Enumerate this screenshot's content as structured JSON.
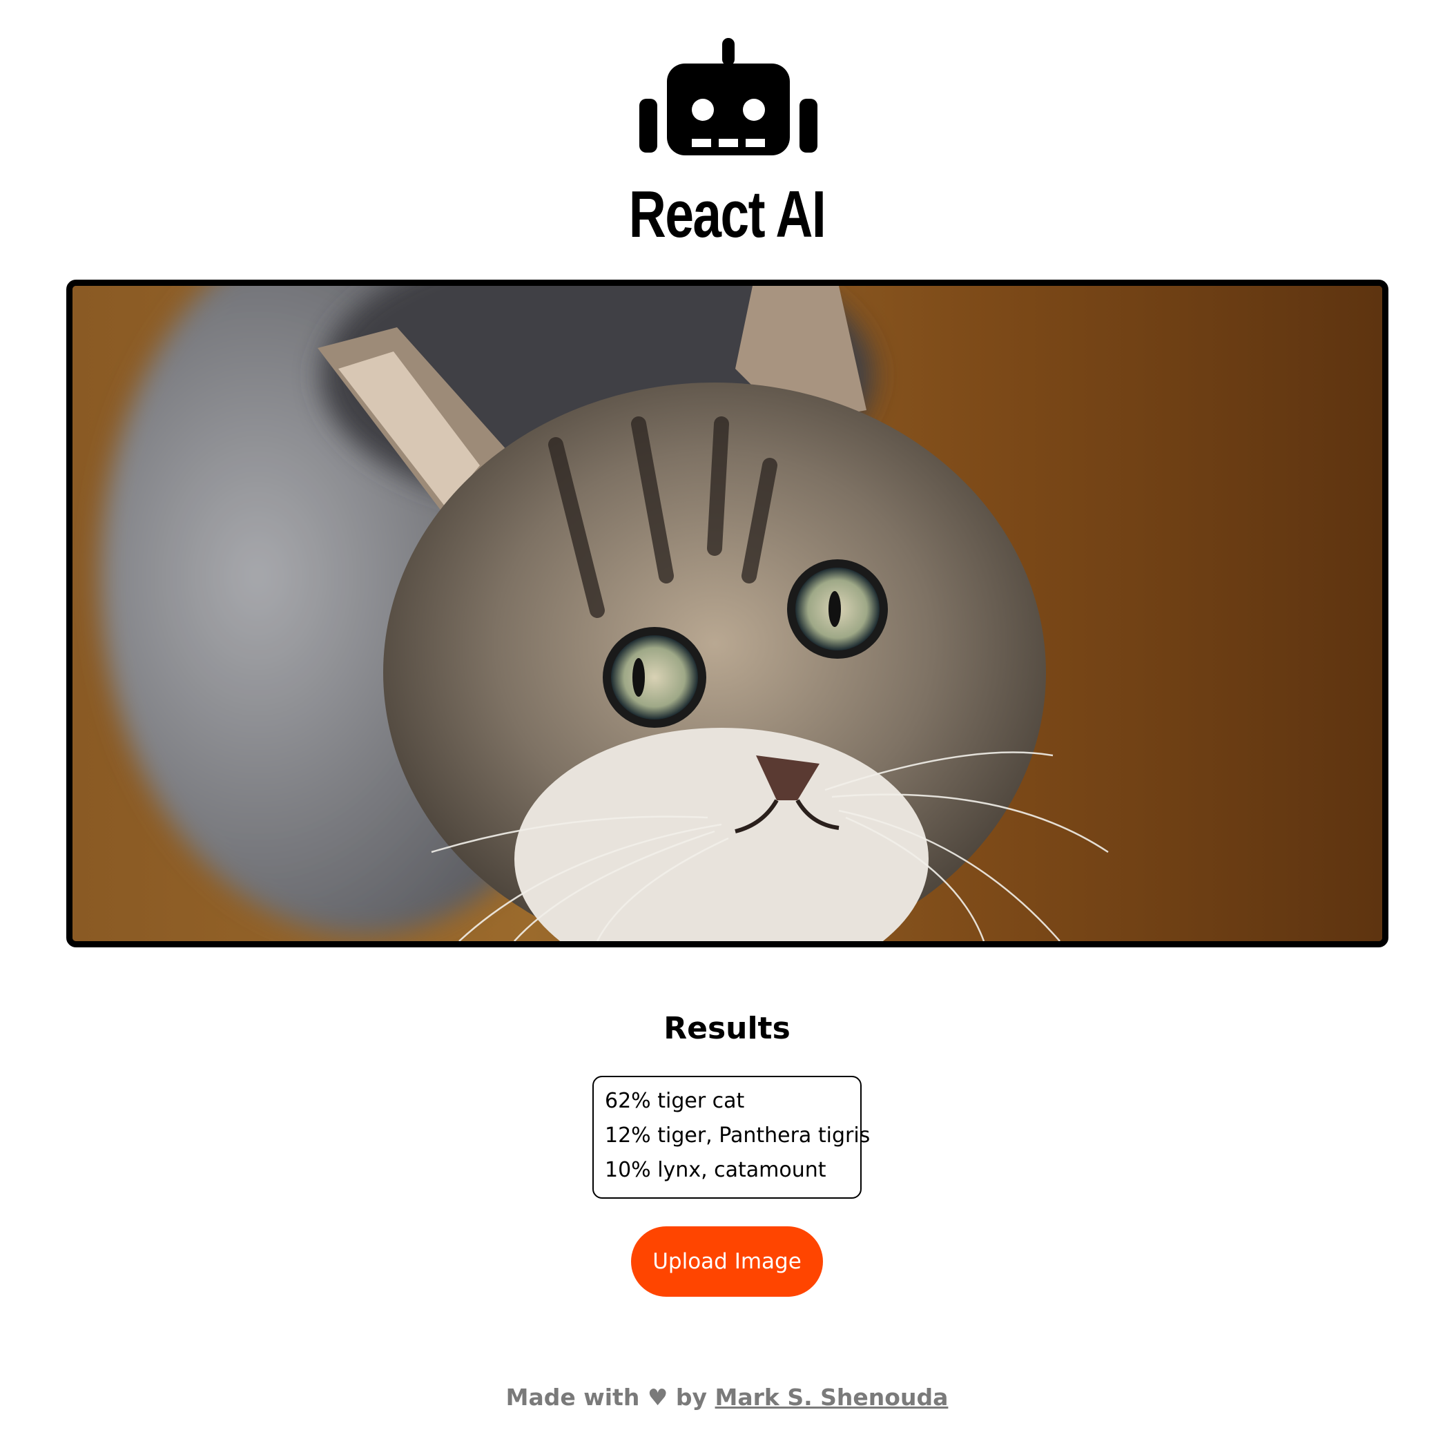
{
  "header": {
    "logo_icon": "robot-icon",
    "brand_name": "React AI"
  },
  "image_preview": {
    "subject": "kitten-photo"
  },
  "results": {
    "title": "Results",
    "predictions": [
      {
        "text": "62% tiger cat",
        "percent": 62,
        "label": "tiger cat"
      },
      {
        "text": "12% tiger, Panthera tigris",
        "percent": 12,
        "label": "tiger, Panthera tigris"
      },
      {
        "text": "10% lynx, catamount",
        "percent": 10,
        "label": "lynx, catamount"
      }
    ]
  },
  "actions": {
    "upload_label": "Upload Image",
    "accent_color": "#ff4500"
  },
  "footer": {
    "prefix": "Made with",
    "heart": "♥",
    "by": "by",
    "author": "Mark S. Shenouda",
    "text_color": "#7a7a7a"
  }
}
